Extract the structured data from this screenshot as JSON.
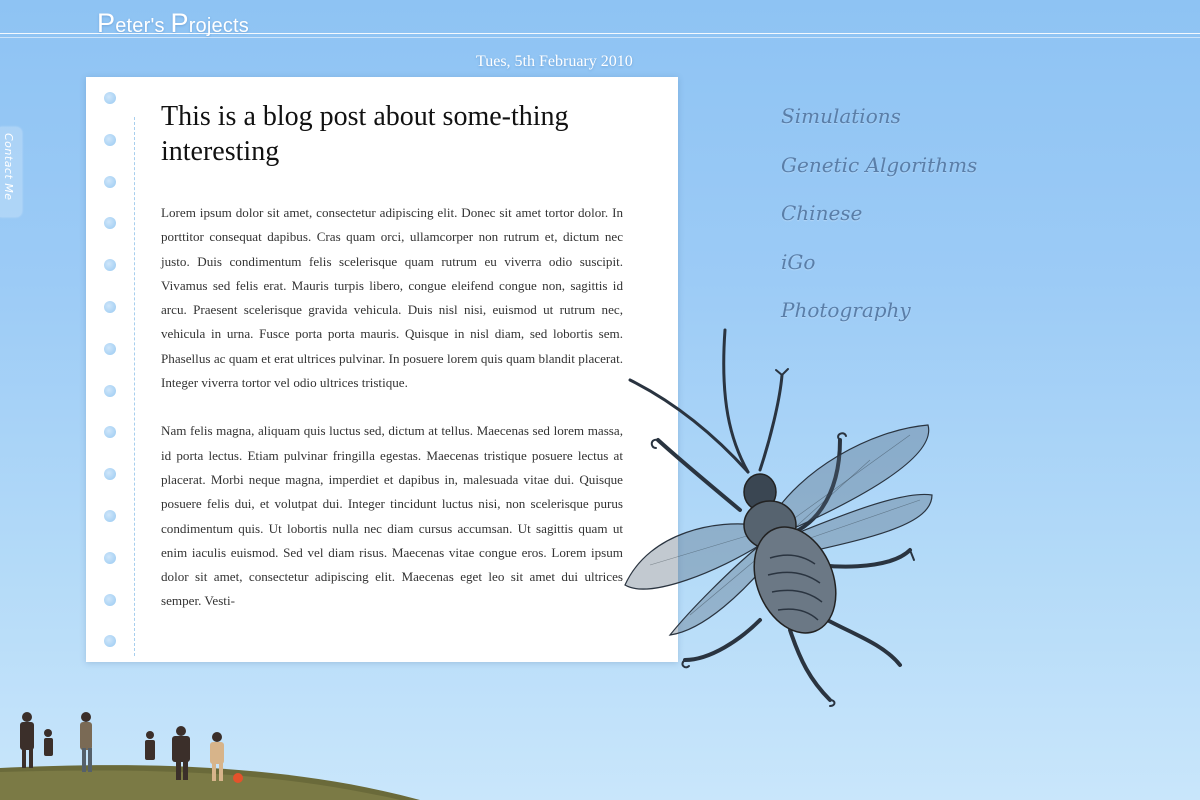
{
  "site": {
    "title_parts": [
      "P",
      "eter's ",
      "P",
      "rojects"
    ],
    "contact_tab": "Contact Me"
  },
  "post": {
    "date": "Tues, 5th February 2010",
    "title": "This is a blog post about some-thing interesting",
    "paragraphs": [
      "Lorem ipsum dolor sit amet, consectetur adipiscing elit. Donec sit amet tortor dolor. In porttitor consequat dapibus. Cras quam orci, ullamcorper non rutrum et, dictum nec justo. Duis condimentum felis scelerisque quam rutrum eu viverra odio suscipit. Vivamus sed felis erat. Mauris turpis libero, congue eleifend congue non, sagittis id arcu. Praesent scelerisque gravida vehicula. Duis nisl nisi, euismod ut rutrum nec, vehicula in urna. Fusce porta porta mauris. Quisque in nisl diam, sed lobortis sem. Phasellus ac quam et erat ultrices pulvinar. In posuere lorem quis quam blandit placerat. Integer viverra tortor vel odio ultrices tristique.",
      "Nam felis magna, aliquam quis luctus sed, dictum at tellus. Maecenas sed lorem massa, id porta lectus. Etiam pulvinar fringilla egestas. Maecenas tristique posuere lectus at placerat. Morbi neque magna, imperdiet et dapibus in, malesuada vitae dui. Quisque posuere felis dui, et volutpat dui. Integer tincidunt luctus nisi, non scelerisque purus condimentum quis. Ut lobortis nulla nec diam cursus accumsan. Ut sagittis quam ut enim iaculis euismod. Sed vel diam risus. Maecenas vitae congue eros. Lorem ipsum dolor sit amet, consectetur adipiscing elit. Maecenas eget leo sit amet dui ultrices semper. Vesti-"
    ]
  },
  "nav": {
    "items": [
      "Simulations",
      "Genetic Algorithms",
      "Chinese",
      "iGo",
      "Photography"
    ]
  },
  "icons": {
    "beetle": "beetle-illustration",
    "spiral_holes": "notebook-hole-icon"
  },
  "colors": {
    "sky_top": "#8ec3f3",
    "sky_bottom": "#c9e6fb",
    "nav_text": "#5a7ea8",
    "card": "#ffffff",
    "hole": "#a9d2f4"
  }
}
